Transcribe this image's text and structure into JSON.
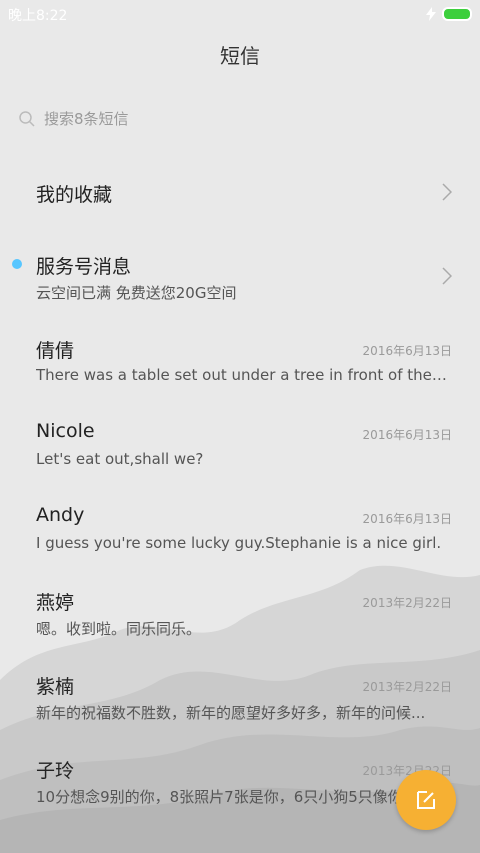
{
  "status": {
    "time": "晚上8:22"
  },
  "header": {
    "title": "短信"
  },
  "search": {
    "placeholder": "搜索8条短信"
  },
  "items": [
    {
      "name": "我的收藏",
      "preview": "",
      "date": "",
      "has_chevron": true,
      "unread": false
    },
    {
      "name": "服务号消息",
      "preview": "云空间已满 免费送您20G空间",
      "date": "",
      "has_chevron": true,
      "unread": true
    },
    {
      "name": "倩倩",
      "preview": "There was a table set out under a tree in front of the ho...",
      "date": "2016年6月13日",
      "has_chevron": false,
      "unread": false
    },
    {
      "name": "Nicole",
      "preview": "Let's eat out,shall we?",
      "date": "2016年6月13日",
      "has_chevron": false,
      "unread": false
    },
    {
      "name": "Andy",
      "preview": "I guess you're some lucky guy.Stephanie is a nice girl.",
      "date": "2016年6月13日",
      "has_chevron": false,
      "unread": false
    },
    {
      "name": "燕婷",
      "preview": "嗯。收到啦。同乐同乐。",
      "date": "2013年2月22日",
      "has_chevron": false,
      "unread": false
    },
    {
      "name": "紫楠",
      "preview": "新年的祝福数不胜数，新年的愿望好多好多，新年的问候...",
      "date": "2013年2月22日",
      "has_chevron": false,
      "unread": false
    },
    {
      "name": "子玲",
      "preview": "10分想念9别的你，8张照片7张是你，6只小狗5只像你",
      "date": "2013年2月22日",
      "has_chevron": false,
      "unread": false
    }
  ],
  "colors": {
    "accent": "#f6b033",
    "unread_dot": "#57c6ff",
    "battery": "#3ccf3c"
  },
  "icons": {
    "search": "search-icon",
    "chevron": "chevron-right-icon",
    "compose": "compose-icon",
    "battery": "battery-icon",
    "charging": "bolt-icon"
  }
}
